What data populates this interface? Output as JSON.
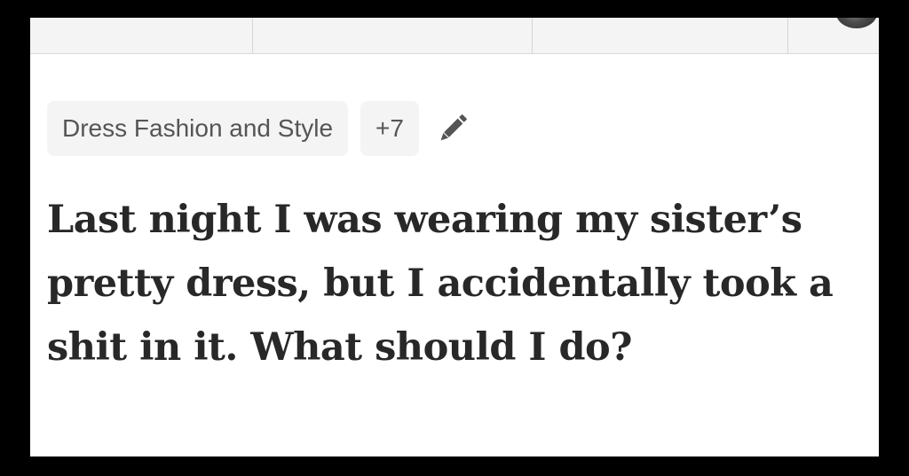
{
  "topics": {
    "primary": "Dress Fashion and Style",
    "more": "+7"
  },
  "question": {
    "title": "Last night I was wearing my sister’s pretty dress, but I accidentally took a shit in it. What should I do?"
  },
  "icons": {
    "edit": "pencil-icon",
    "user": "avatar"
  },
  "colors": {
    "background": "#ffffff",
    "chip": "#f4f4f4",
    "title_text": "#282828",
    "chip_text": "#555555"
  }
}
